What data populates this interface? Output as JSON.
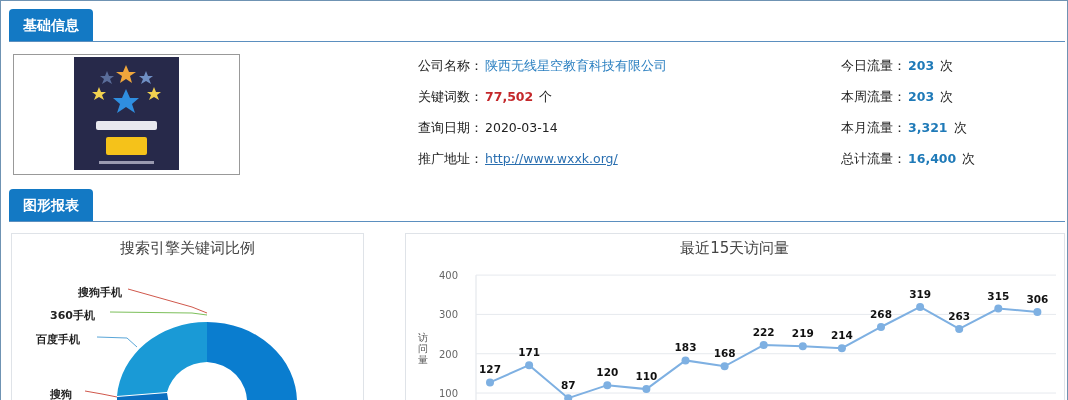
{
  "basic_section": {
    "title": "基础信息",
    "info_left": [
      {
        "label": "公司名称：",
        "value": "陕西无线星空教育科技有限公司",
        "kind": "link"
      },
      {
        "label": "关键词数：",
        "value": "77,502",
        "unit": "个",
        "kind": "count"
      },
      {
        "label": "查询日期：",
        "value": "2020-03-14",
        "kind": "text"
      },
      {
        "label": "推广地址：",
        "value": "http://www.wxxk.org/",
        "kind": "url"
      }
    ],
    "info_right": [
      {
        "label": "今日流量：",
        "value": "203",
        "unit": "次"
      },
      {
        "label": "本周流量：",
        "value": "203",
        "unit": "次"
      },
      {
        "label": "本月流量：",
        "value": "3,321",
        "unit": "次"
      },
      {
        "label": "总计流量：",
        "value": "16,400",
        "unit": "次"
      }
    ]
  },
  "chart_section": {
    "title": "图形报表",
    "pie_panel": {
      "title": "搜索引擎关键词比例",
      "labels": [
        "搜狗手机",
        "360手机",
        "百度手机",
        "搜狗"
      ]
    },
    "line_panel": {
      "chart_data": {
        "type": "line",
        "title": "最近15天访问量",
        "ylabel": "访问量",
        "ylim": [
          80,
          400
        ],
        "grid": true,
        "yticks": [
          100,
          200,
          300,
          400
        ],
        "data_labels": true,
        "series": [
          {
            "color": "#7eb0e2",
            "marker": "circle",
            "values": [
              127,
              171,
              87,
              120,
              110,
              183,
              168,
              222,
              219,
              214,
              268,
              319,
              263,
              315,
              306
            ]
          }
        ]
      }
    }
  }
}
